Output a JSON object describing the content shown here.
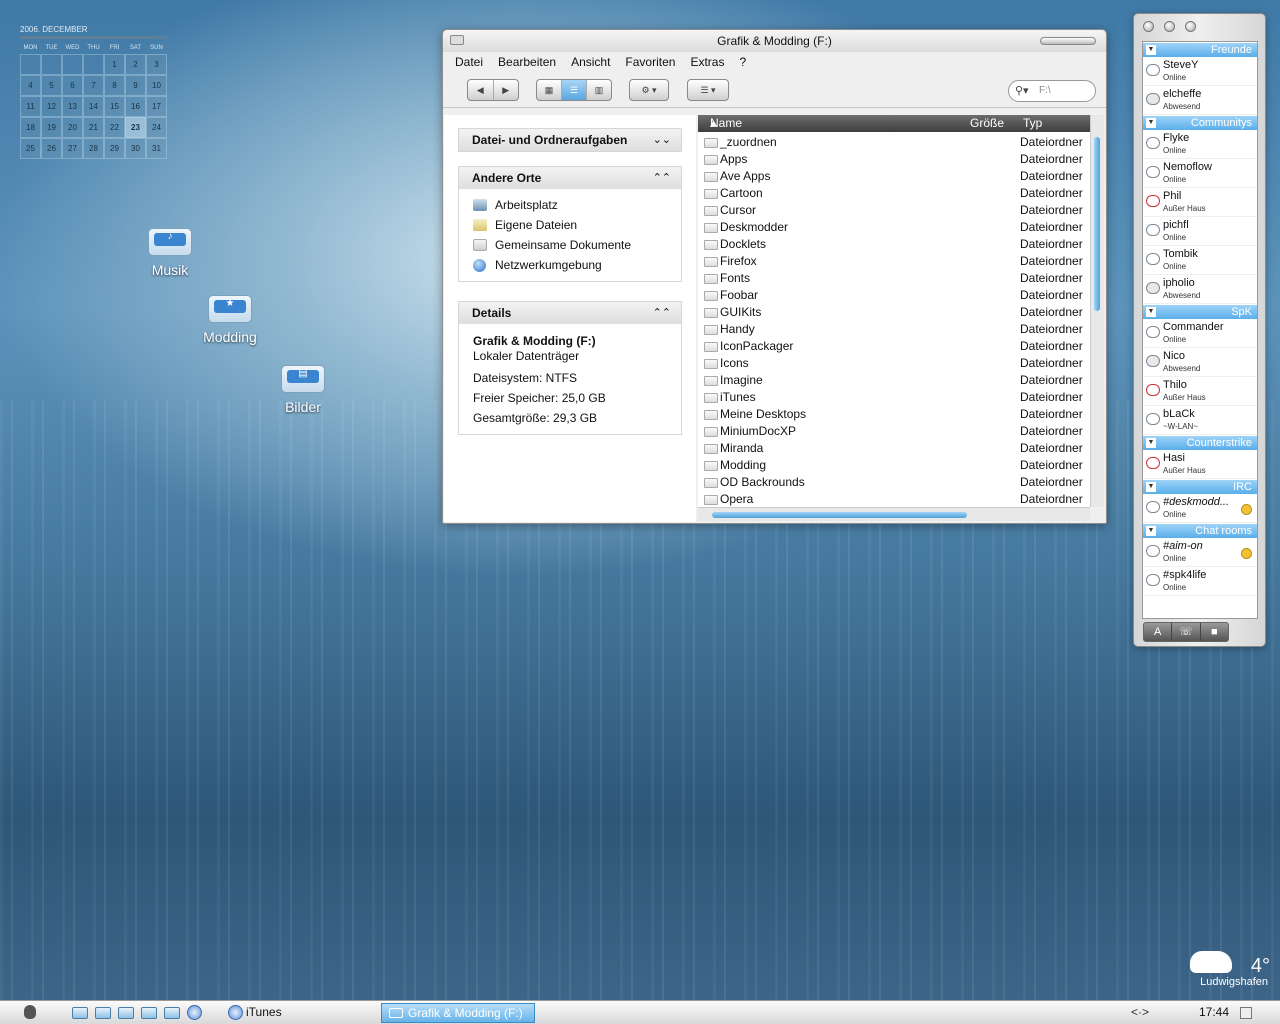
{
  "calendar": {
    "title": "2006. DECEMBER",
    "weekdays": [
      "MON",
      "TUE",
      "WED",
      "THU",
      "FRI",
      "SAT",
      "SUN"
    ],
    "days": [
      "",
      "",
      "",
      "",
      "1",
      "2",
      "3",
      "4",
      "5",
      "6",
      "7",
      "8",
      "9",
      "10",
      "11",
      "12",
      "13",
      "14",
      "15",
      "16",
      "17",
      "18",
      "19",
      "20",
      "21",
      "22",
      "23",
      "24",
      "25",
      "26",
      "27",
      "28",
      "29",
      "30",
      "31"
    ],
    "today": "23"
  },
  "desktop_icons": [
    {
      "label": "Musik",
      "symbol": "♪"
    },
    {
      "label": "Modding",
      "symbol": "★"
    },
    {
      "label": "Bilder",
      "symbol": "▤"
    }
  ],
  "explorer": {
    "title": "Grafik & Modding (F:)",
    "menu": [
      "Datei",
      "Bearbeiten",
      "Ansicht",
      "Favoriten",
      "Extras",
      "?"
    ],
    "search_placeholder": "F:\\",
    "tasks_header": "Datei- und Ordneraufgaben",
    "places_header": "Andere Orte",
    "places": [
      "Arbeitsplatz",
      "Eigene Dateien",
      "Gemeinsame Dokumente",
      "Netzwerkumgebung"
    ],
    "details_header": "Details",
    "details": {
      "name": "Grafik & Modding (F:)",
      "kind": "Lokaler Datenträger",
      "filesystem": "Dateisystem: NTFS",
      "free": "Freier Speicher: 25,0 GB",
      "total": "Gesamtgröße: 29,3 GB"
    },
    "columns": {
      "name": "Name",
      "size": "Größe",
      "type": "Typ"
    },
    "files": [
      {
        "name": "_zuordnen",
        "type": "Dateiordner"
      },
      {
        "name": "Apps",
        "type": "Dateiordner"
      },
      {
        "name": "Ave Apps",
        "type": "Dateiordner"
      },
      {
        "name": "Cartoon",
        "type": "Dateiordner"
      },
      {
        "name": "Cursor",
        "type": "Dateiordner"
      },
      {
        "name": "Deskmodder",
        "type": "Dateiordner"
      },
      {
        "name": "Docklets",
        "type": "Dateiordner"
      },
      {
        "name": "Firefox",
        "type": "Dateiordner"
      },
      {
        "name": "Fonts",
        "type": "Dateiordner"
      },
      {
        "name": "Foobar",
        "type": "Dateiordner"
      },
      {
        "name": "GUIKits",
        "type": "Dateiordner"
      },
      {
        "name": "Handy",
        "type": "Dateiordner"
      },
      {
        "name": "IconPackager",
        "type": "Dateiordner"
      },
      {
        "name": "Icons",
        "type": "Dateiordner"
      },
      {
        "name": "Imagine",
        "type": "Dateiordner"
      },
      {
        "name": "iTunes",
        "type": "Dateiordner"
      },
      {
        "name": "Meine Desktops",
        "type": "Dateiordner"
      },
      {
        "name": "MiniumDocXP",
        "type": "Dateiordner"
      },
      {
        "name": "Miranda",
        "type": "Dateiordner"
      },
      {
        "name": "Modding",
        "type": "Dateiordner"
      },
      {
        "name": "OD Backrounds",
        "type": "Dateiordner"
      },
      {
        "name": "Opera",
        "type": "Dateiordner"
      }
    ]
  },
  "buddy": {
    "groups": [
      {
        "name": "Freunde",
        "contacts": [
          {
            "name": "SteveY",
            "status": "Online",
            "state": "online"
          },
          {
            "name": "elcheffe",
            "status": "Abwesend",
            "state": "away"
          }
        ]
      },
      {
        "name": "Communitys",
        "contacts": [
          {
            "name": "Flyke",
            "status": "Online",
            "state": "online"
          },
          {
            "name": "Nemoflow",
            "status": "Online",
            "state": "online"
          },
          {
            "name": "Phil",
            "status": "Außer Haus",
            "state": "off"
          },
          {
            "name": "pichfl",
            "status": "Online",
            "state": "online"
          },
          {
            "name": "Tombik",
            "status": "Online",
            "state": "online"
          },
          {
            "name": "ipholio",
            "status": "Abwesend",
            "state": "away"
          }
        ]
      },
      {
        "name": "SpK",
        "contacts": [
          {
            "name": "Commander",
            "status": "Online",
            "state": "online"
          },
          {
            "name": "Nico",
            "status": "Abwesend",
            "state": "away"
          },
          {
            "name": "Thilo",
            "status": "Außer Haus",
            "state": "off"
          },
          {
            "name": "bLaCk",
            "status": "~W-LAN~",
            "state": "online"
          }
        ]
      },
      {
        "name": "Counterstrike",
        "contacts": [
          {
            "name": "Hasi",
            "status": "Außer Haus",
            "state": "off"
          }
        ]
      },
      {
        "name": "IRC",
        "contacts": [
          {
            "name": "#deskmodd...",
            "status": "Online",
            "state": "online",
            "italic": true,
            "smiley": true
          }
        ]
      },
      {
        "name": "Chat rooms",
        "contacts": [
          {
            "name": "#aim-on",
            "status": "Online",
            "state": "online",
            "italic": true,
            "smiley": true
          },
          {
            "name": "#spk4life",
            "status": "Online",
            "state": "online"
          }
        ]
      }
    ],
    "bottom_buttons": [
      "A",
      "☏",
      "■"
    ]
  },
  "weather": {
    "temp": "4°",
    "city": "Ludwigshafen"
  },
  "taskbar": {
    "itunes_label": "iTunes",
    "active_task": "Grafik & Modding (F:)",
    "tray": "<·>",
    "clock": "17:44"
  }
}
